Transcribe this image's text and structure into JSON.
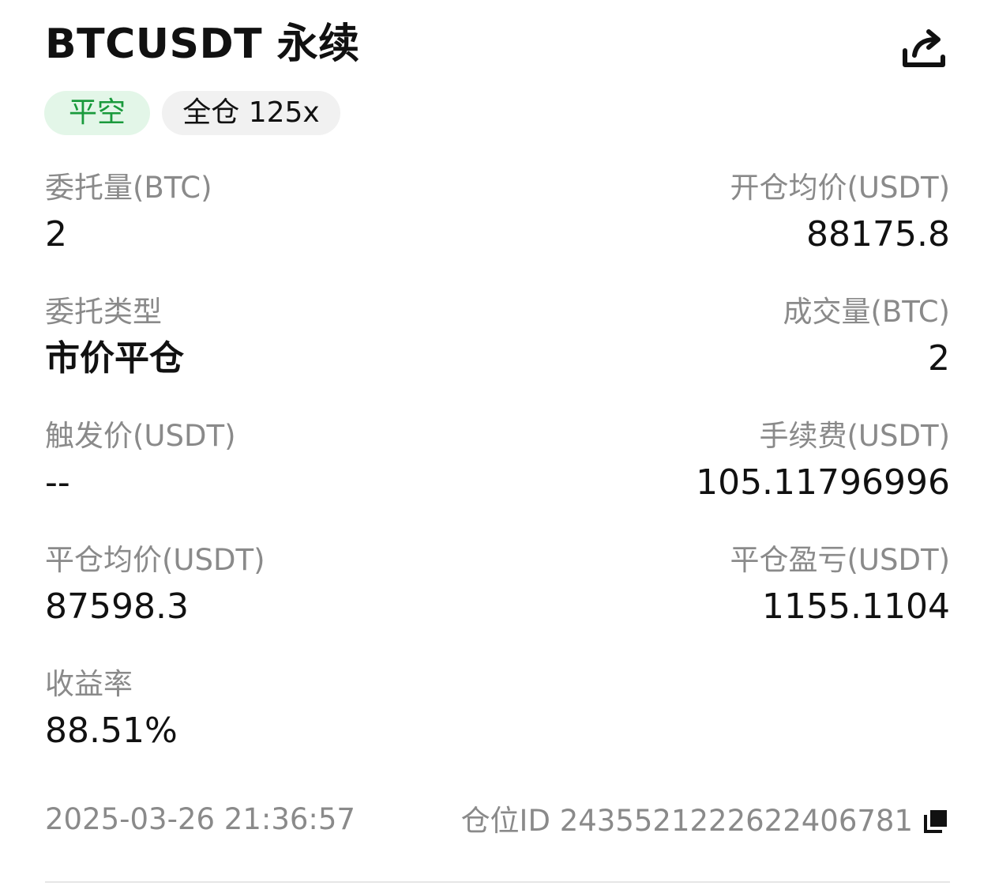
{
  "header": {
    "title": "BTCUSDT 永续",
    "share_icon": "share-icon"
  },
  "tags": {
    "side": "平空",
    "margin": "全仓 125x"
  },
  "colors": {
    "side_tag_bg": "#e3f6e8",
    "side_tag_text": "#1a9a3c",
    "label_gray": "#8a8a8a"
  },
  "fields": {
    "order_qty": {
      "label": "委托量(BTC)",
      "value": "2"
    },
    "open_avg_price": {
      "label": "开仓均价(USDT)",
      "value": "88175.8"
    },
    "order_type": {
      "label": "委托类型",
      "value": "市价平仓"
    },
    "filled_qty": {
      "label": "成交量(BTC)",
      "value": "2"
    },
    "trigger_price": {
      "label": "触发价(USDT)",
      "value": "--"
    },
    "fee": {
      "label": "手续费(USDT)",
      "value": "105.11796996"
    },
    "close_avg_price": {
      "label": "平仓均价(USDT)",
      "value": "87598.3"
    },
    "close_pnl": {
      "label": "平仓盈亏(USDT)",
      "value": "1155.1104"
    },
    "roi": {
      "label": "收益率",
      "value": "88.51%"
    }
  },
  "footer": {
    "timestamp": "2025-03-26 21:36:57",
    "position_id": "仓位ID 243552122262240678​1",
    "copy_icon": "copy-icon"
  }
}
